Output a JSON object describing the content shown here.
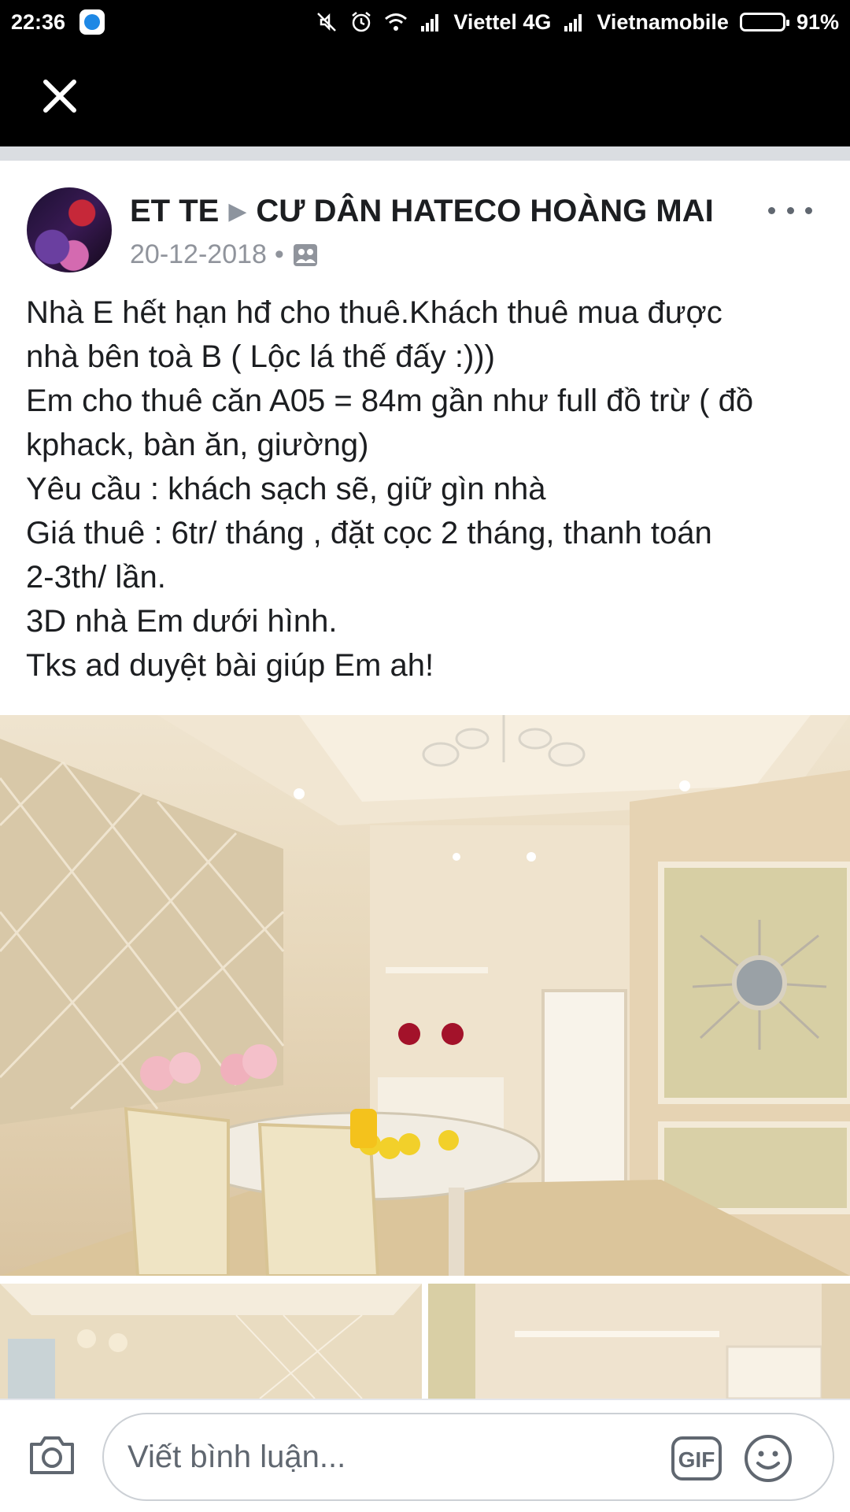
{
  "status_bar": {
    "time": "22:36",
    "carrier1": "Viettel 4G",
    "carrier2": "Vietnamobile",
    "battery": "91%",
    "battery_level": 0.91
  },
  "post": {
    "author": "ET TE",
    "group": "CƯ DÂN HATECO HOÀNG MAI",
    "date": "20-12-2018",
    "separator": "•",
    "lines": [
      "Nhà E hết hạn hđ cho thuê.Khách thuê mua được",
      "nhà bên toà B ( Lộc lá thế đấy :)))",
      "Em cho thuê căn A05 = 84m gần như full đồ trừ ( đồ",
      "kphack, bàn ăn, giường)",
      "Yêu cầu : khách sạch sẽ, giữ gìn nhà",
      "Giá thuê : 6tr/ tháng , đặt cọc 2 tháng, thanh toán",
      "2-3th/ lần.",
      "3D nhà Em dưới hình.",
      "Tks ad duyệt bài giúp Em ah!"
    ]
  },
  "comment": {
    "placeholder": "Viết bình luận...",
    "gif_label": "GIF"
  },
  "colors": {
    "text": "#1c1e21",
    "meta": "#90949c",
    "divider": "#dadde1"
  },
  "icons": [
    "message-app-icon",
    "mute-icon",
    "alarm-icon",
    "wifi-icon",
    "signal-icon",
    "battery-icon",
    "close-icon",
    "group-icon",
    "more-icon",
    "camera-icon",
    "gif-icon",
    "emoji-icon"
  ]
}
